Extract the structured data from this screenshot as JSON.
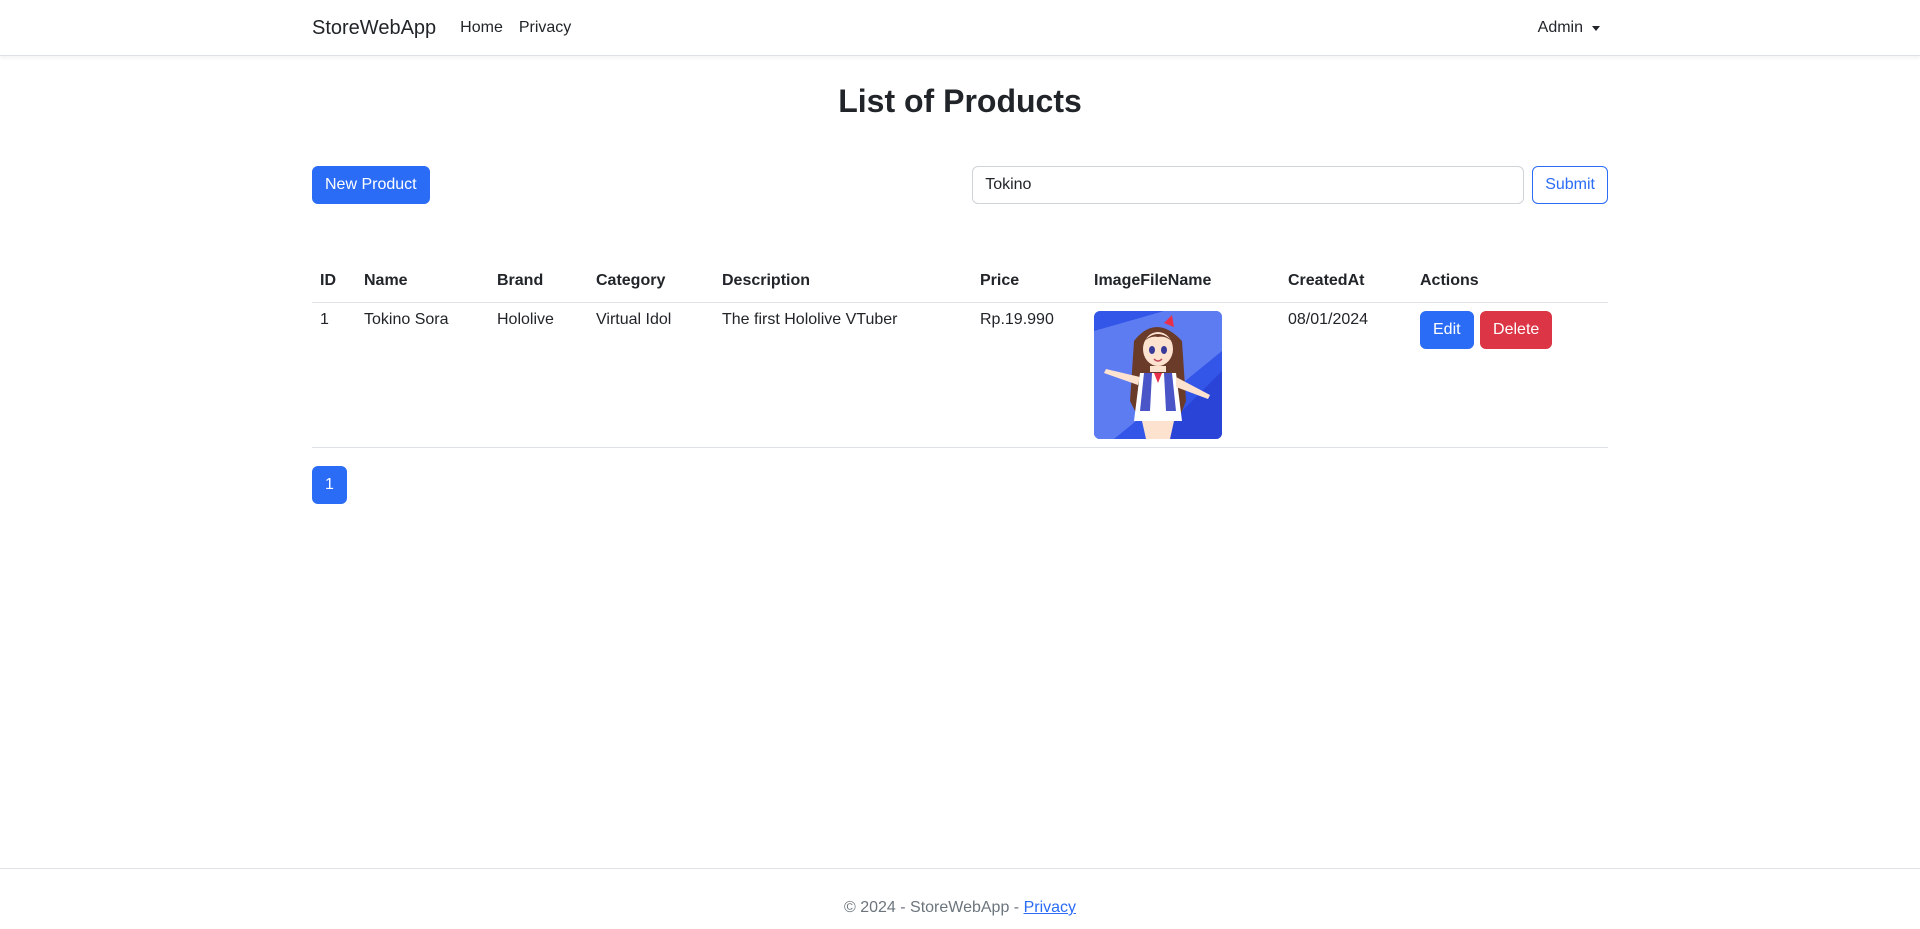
{
  "nav": {
    "brand": "StoreWebApp",
    "links": [
      "Home",
      "Privacy"
    ],
    "user": "Admin"
  },
  "page": {
    "title": "List of Products"
  },
  "toolbar": {
    "new_label": "New Product",
    "search_value": "Tokino",
    "submit_label": "Submit"
  },
  "table": {
    "headers": [
      "ID",
      "Name",
      "Brand",
      "Category",
      "Description",
      "Price",
      "ImageFileName",
      "CreatedAt",
      "Actions"
    ],
    "rows": [
      {
        "id": "1",
        "name": "Tokino Sora",
        "brand": "Hololive",
        "category": "Virtual Idol",
        "description": "The first Hololive VTuber",
        "price": "Rp.19.990",
        "image": "anime-character-image",
        "created": "08/01/2024",
        "edit_label": "Edit",
        "delete_label": "Delete"
      }
    ]
  },
  "pagination": {
    "current": "1"
  },
  "footer": {
    "text": "© 2024 - StoreWebApp - ",
    "link": "Privacy"
  },
  "colors": {
    "primary": "#2a6cf6",
    "danger": "#dc3545",
    "muted": "#6c757d"
  }
}
